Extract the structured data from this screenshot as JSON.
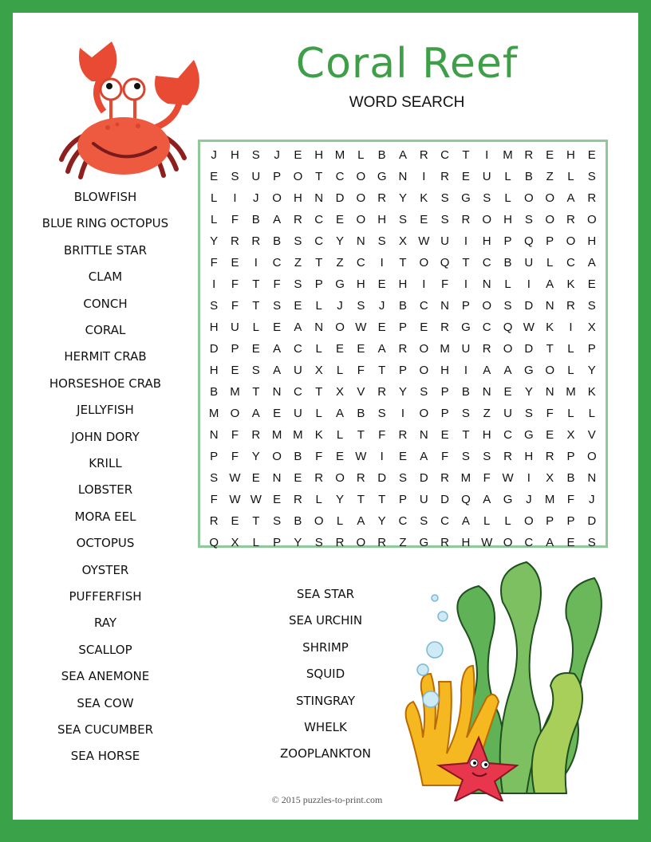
{
  "header": {
    "title": "Coral Reef",
    "subtitle": "WORD SEARCH"
  },
  "colors": {
    "border": "#3aa34a",
    "title": "#3f9f48",
    "grid_border": "#8fc99a"
  },
  "grid": {
    "rows": [
      [
        "J",
        "H",
        "S",
        "J",
        "E",
        "H",
        "M",
        "L",
        "B",
        "A",
        "R",
        "C",
        "T",
        "I",
        "M",
        "R",
        "E",
        "H",
        "E"
      ],
      [
        "E",
        "S",
        "U",
        "P",
        "O",
        "T",
        "C",
        "O",
        "G",
        "N",
        "I",
        "R",
        "E",
        "U",
        "L",
        "B",
        "Z",
        "L",
        "S"
      ],
      [
        "L",
        "I",
        "J",
        "O",
        "H",
        "N",
        "D",
        "O",
        "R",
        "Y",
        "K",
        "S",
        "G",
        "S",
        "L",
        "O",
        "O",
        "A",
        "R"
      ],
      [
        "L",
        "F",
        "B",
        "A",
        "R",
        "C",
        "E",
        "O",
        "H",
        "S",
        "E",
        "S",
        "R",
        "O",
        "H",
        "S",
        "O",
        "R",
        "O"
      ],
      [
        "Y",
        "R",
        "R",
        "B",
        "S",
        "C",
        "Y",
        "N",
        "S",
        "X",
        "W",
        "U",
        "I",
        "H",
        "P",
        "Q",
        "P",
        "O",
        "H"
      ],
      [
        "F",
        "E",
        "I",
        "C",
        "Z",
        "T",
        "Z",
        "C",
        "I",
        "T",
        "O",
        "Q",
        "T",
        "C",
        "B",
        "U",
        "L",
        "C",
        "A"
      ],
      [
        "I",
        "F",
        "T",
        "F",
        "S",
        "P",
        "G",
        "H",
        "E",
        "H",
        "I",
        "F",
        "I",
        "N",
        "L",
        "I",
        "A",
        "K",
        "E"
      ],
      [
        "S",
        "F",
        "T",
        "S",
        "E",
        "L",
        "J",
        "S",
        "J",
        "B",
        "C",
        "N",
        "P",
        "O",
        "S",
        "D",
        "N",
        "R",
        "S"
      ],
      [
        "H",
        "U",
        "L",
        "E",
        "A",
        "N",
        "O",
        "W",
        "E",
        "P",
        "E",
        "R",
        "G",
        "C",
        "Q",
        "W",
        "K",
        "I",
        "X"
      ],
      [
        "D",
        "P",
        "E",
        "A",
        "C",
        "L",
        "E",
        "E",
        "A",
        "R",
        "O",
        "M",
        "U",
        "R",
        "O",
        "D",
        "T",
        "L",
        "P"
      ],
      [
        "H",
        "E",
        "S",
        "A",
        "U",
        "X",
        "L",
        "F",
        "T",
        "P",
        "O",
        "H",
        "I",
        "A",
        "A",
        "G",
        "O",
        "L",
        "Y"
      ],
      [
        "B",
        "M",
        "T",
        "N",
        "C",
        "T",
        "X",
        "V",
        "R",
        "Y",
        "S",
        "P",
        "B",
        "N",
        "E",
        "Y",
        "N",
        "M",
        "K"
      ],
      [
        "M",
        "O",
        "A",
        "E",
        "U",
        "L",
        "A",
        "B",
        "S",
        "I",
        "O",
        "P",
        "S",
        "Z",
        "U",
        "S",
        "F",
        "L",
        "L"
      ],
      [
        "N",
        "F",
        "R",
        "M",
        "M",
        "K",
        "L",
        "T",
        "F",
        "R",
        "N",
        "E",
        "T",
        "H",
        "C",
        "G",
        "E",
        "X",
        "V"
      ],
      [
        "P",
        "F",
        "Y",
        "O",
        "B",
        "F",
        "E",
        "W",
        "I",
        "E",
        "A",
        "F",
        "S",
        "S",
        "R",
        "H",
        "R",
        "P",
        "O"
      ],
      [
        "S",
        "W",
        "E",
        "N",
        "E",
        "R",
        "O",
        "R",
        "D",
        "S",
        "D",
        "R",
        "M",
        "F",
        "W",
        "I",
        "X",
        "B",
        "N"
      ],
      [
        "F",
        "W",
        "W",
        "E",
        "R",
        "L",
        "Y",
        "T",
        "T",
        "P",
        "U",
        "D",
        "Q",
        "A",
        "G",
        "J",
        "M",
        "F",
        "J"
      ],
      [
        "R",
        "E",
        "T",
        "S",
        "B",
        "O",
        "L",
        "A",
        "Y",
        "C",
        "S",
        "C",
        "A",
        "L",
        "L",
        "O",
        "P",
        "P",
        "D"
      ],
      [
        "Q",
        "X",
        "L",
        "P",
        "Y",
        "S",
        "R",
        "O",
        "R",
        "Z",
        "G",
        "R",
        "H",
        "W",
        "O",
        "C",
        "A",
        "E",
        "S"
      ]
    ]
  },
  "word_list": {
    "column1": [
      "BLOWFISH",
      "BLUE RING OCTOPUS",
      "BRITTLE STAR",
      "CLAM",
      "CONCH",
      "CORAL",
      "HERMIT CRAB",
      "HORSESHOE CRAB",
      "JELLYFISH",
      "JOHN DORY",
      "KRILL",
      "LOBSTER",
      "MORA EEL",
      "OCTOPUS",
      "OYSTER",
      "PUFFERFISH",
      "RAY",
      "SCALLOP",
      "SEA ANEMONE",
      "SEA COW",
      "SEA CUCUMBER",
      "SEA HORSE"
    ],
    "column2": [
      "SEA STAR",
      "SEA URCHIN",
      "SHRIMP",
      "SQUID",
      "STINGRAY",
      "WHELK",
      "ZOOPLANKTON"
    ]
  },
  "illustrations": {
    "top_left": "crab-illustration",
    "bottom_right": "seaweed-coral-starfish-illustration"
  },
  "footer": {
    "copyright": "© 2015 puzzles-to-print.com"
  }
}
